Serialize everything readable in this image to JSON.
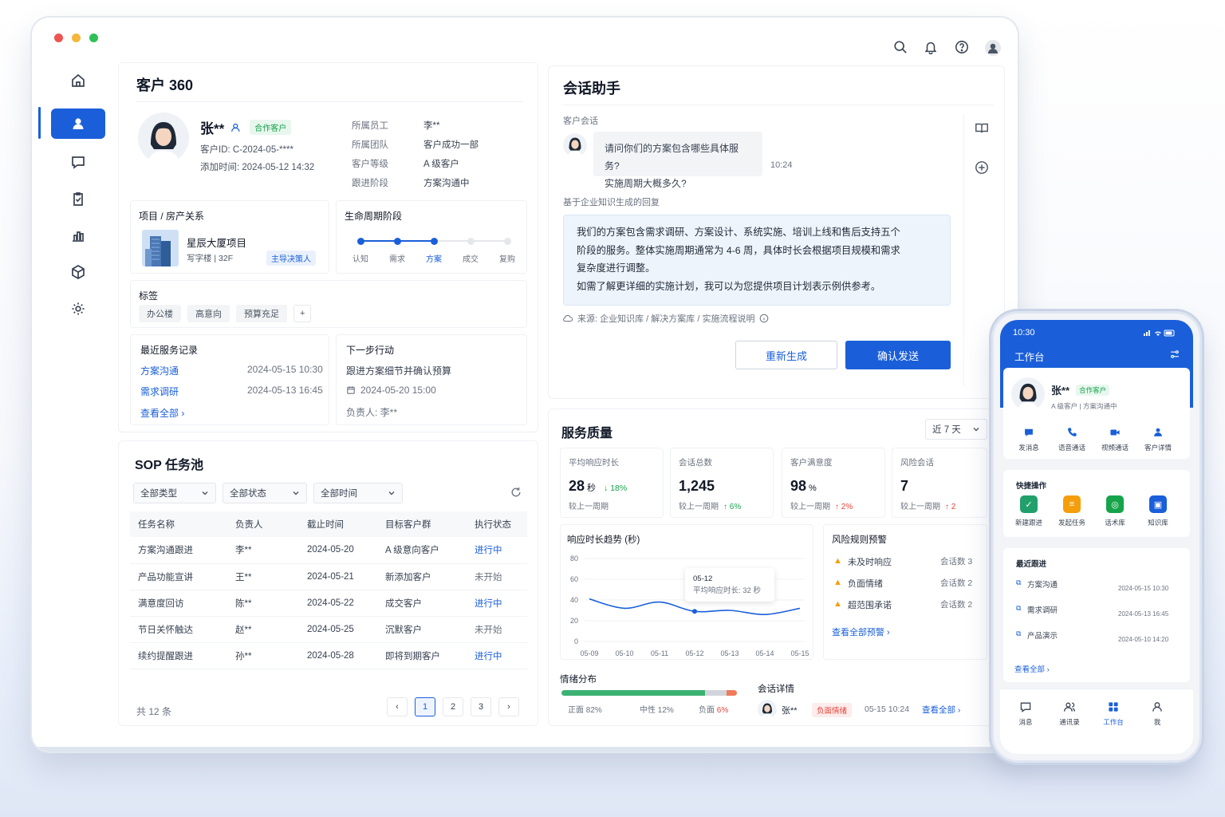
{
  "customer360": {
    "title": "客户 360",
    "name": "张**",
    "badge": "合作客户",
    "customer_id": "客户ID:  C-2024-05-****",
    "added_time": "添加时间:  2024-05-12 14:32",
    "info": [
      {
        "label": "所属员工",
        "value": "李**"
      },
      {
        "label": "所属团队",
        "value": "客户成功一部"
      },
      {
        "label": "客户等级",
        "value": "A 级客户"
      },
      {
        "label": "跟进阶段",
        "value": "方案沟通中"
      }
    ],
    "project": {
      "title": "项目 / 房产关系",
      "name": "星辰大厦项目",
      "desc": "写字楼 | 32F",
      "role": "主导决策人"
    },
    "lifecycle": {
      "title": "生命周期阶段",
      "stages": [
        "认知",
        "需求",
        "方案",
        "成交",
        "复购"
      ],
      "current": 2
    },
    "tags": {
      "title": "标签",
      "items": [
        "办公楼",
        "高意向",
        "预算充足"
      ],
      "add": "+"
    },
    "service": {
      "title": "最近服务记录",
      "records": [
        {
          "name": "方案沟通",
          "time": "2024-05-15 10:30"
        },
        {
          "name": "需求调研",
          "time": "2024-05-13 16:45"
        }
      ],
      "view_all": "查看全部 ›"
    },
    "next": {
      "title": "下一步行动",
      "action": "跟进方案细节并确认预算",
      "time": "2024-05-20 15:00",
      "owner": "负责人:  李**"
    }
  },
  "sop": {
    "title": "SOP 任务池",
    "filters": [
      "全部类型",
      "全部状态",
      "全部时间"
    ],
    "columns": [
      "任务名称",
      "负责人",
      "截止时间",
      "目标客户群",
      "执行状态"
    ],
    "rows": [
      {
        "name": "方案沟通跟进",
        "owner": "李**",
        "due": "2024-05-20",
        "group": "A 级意向客户",
        "status": "进行中"
      },
      {
        "name": "产品功能宣讲",
        "owner": "王**",
        "due": "2024-05-21",
        "group": "新添加客户",
        "status": "未开始"
      },
      {
        "name": "满意度回访",
        "owner": "陈**",
        "due": "2024-05-22",
        "group": "成交客户",
        "status": "进行中"
      },
      {
        "name": "节日关怀触达",
        "owner": "赵**",
        "due": "2024-05-25",
        "group": "沉默客户",
        "status": "未开始"
      },
      {
        "name": "续约提醒跟进",
        "owner": "孙**",
        "due": "2024-05-28",
        "group": "即将到期客户",
        "status": "进行中"
      }
    ],
    "total": "共 12 条",
    "pages": [
      "1",
      "2",
      "3"
    ],
    "prev": "‹",
    "next": "›"
  },
  "assistant": {
    "title": "会话助手",
    "conv_label": "客户会话",
    "question_line1": "请问你们的方案包含哪些具体服务?",
    "question_line2": "实施周期大概多久?",
    "question_time": "10:24",
    "reply_label": "基于企业知识生成的回复",
    "reply_lines": [
      "我们的方案包含需求调研、方案设计、系统实施、培训上线和售后支持五个",
      "阶段的服务。整体实施周期通常为 4-6 周，具体时长会根据项目规模和需求",
      "复杂度进行调整。",
      "如需了解更详细的实施计划，我可以为您提供项目计划表示例供参考。"
    ],
    "source": "来源:  企业知识库 / 解决方案库 / 实施流程说明",
    "regenerate": "重新生成",
    "confirm": "确认发送"
  },
  "quality": {
    "title": "服务质量",
    "range": "近 7 天",
    "metrics": [
      {
        "title": "平均响应时长",
        "value": "28",
        "unit": "秒",
        "change": "18%",
        "change_dir": "down",
        "sub": "较上一周期"
      },
      {
        "title": "会话总数",
        "value": "1,245",
        "unit": "",
        "change": "6%",
        "change_dir": "up",
        "sub": "较上一周期"
      },
      {
        "title": "客户满意度",
        "value": "98",
        "unit": "%",
        "change": "2%",
        "change_dir": "up-red",
        "sub": "较上一周期"
      },
      {
        "title": "风险会话",
        "value": "7",
        "unit": "",
        "change": "2",
        "change_dir": "up-red",
        "sub": "较上一周期"
      }
    ],
    "trend": {
      "title": "响应时长趋势 (秒)",
      "tooltip_date": "05-12",
      "tooltip_text": "平均响应时长:  32 秒"
    },
    "alerts": {
      "title": "风险规则预警",
      "items": [
        {
          "name": "未及时响应",
          "count": "会话数  3"
        },
        {
          "name": "负面情绪",
          "count": "会话数  2"
        },
        {
          "name": "超范围承诺",
          "count": "会话数  2"
        }
      ],
      "view_all": "查看全部预警 ›"
    },
    "emotion": {
      "title": "情绪分布",
      "positive": "正面  82%",
      "neutral": "中性  12%",
      "negative": "负面  ",
      "negative_val": "6%",
      "positive_pct": 82,
      "neutral_pct": 12,
      "negative_pct": 6
    },
    "detail": {
      "title": "会话详情",
      "name": "张**",
      "tag": "负面情绪",
      "time": "05-15 10:24",
      "view_all": "查看全部 ›"
    }
  },
  "chart_data": {
    "type": "line",
    "title": "响应时长趋势 (秒)",
    "x": [
      "05-09",
      "05-10",
      "05-11",
      "05-12",
      "05-13",
      "05-14",
      "05-15"
    ],
    "series": [
      {
        "values": [
          41,
          32,
          38,
          29,
          30,
          26,
          32
        ]
      }
    ],
    "ylim": [
      0,
      80
    ],
    "yticks": [
      "80",
      "60",
      "40",
      "20",
      "0"
    ]
  },
  "phone": {
    "time": "10:30",
    "header": "工作台",
    "name": "张**",
    "badge": "合作客户",
    "desc": "A 级客户 | 方案沟通中",
    "actions": [
      "发消息",
      "语音通话",
      "视频通话",
      "客户详情"
    ],
    "quick_title": "快捷操作",
    "quick": [
      "新建跟进",
      "发起任务",
      "话术库",
      "知识库"
    ],
    "recent_title": "最近跟进",
    "recent": [
      {
        "name": "方案沟通",
        "time": "2024-05-15 10:30"
      },
      {
        "name": "需求调研",
        "time": "2024-05-13 16:45"
      },
      {
        "name": "产品演示",
        "time": "2024-05-10 14:20"
      }
    ],
    "view_all": "查看全部 ›",
    "tabs": [
      "消息",
      "通讯录",
      "工作台",
      "我"
    ]
  },
  "colors": {
    "accent": "#1a5fd9",
    "green": "#16a34a",
    "red": "#e0453a",
    "orange": "#f59e0b"
  }
}
